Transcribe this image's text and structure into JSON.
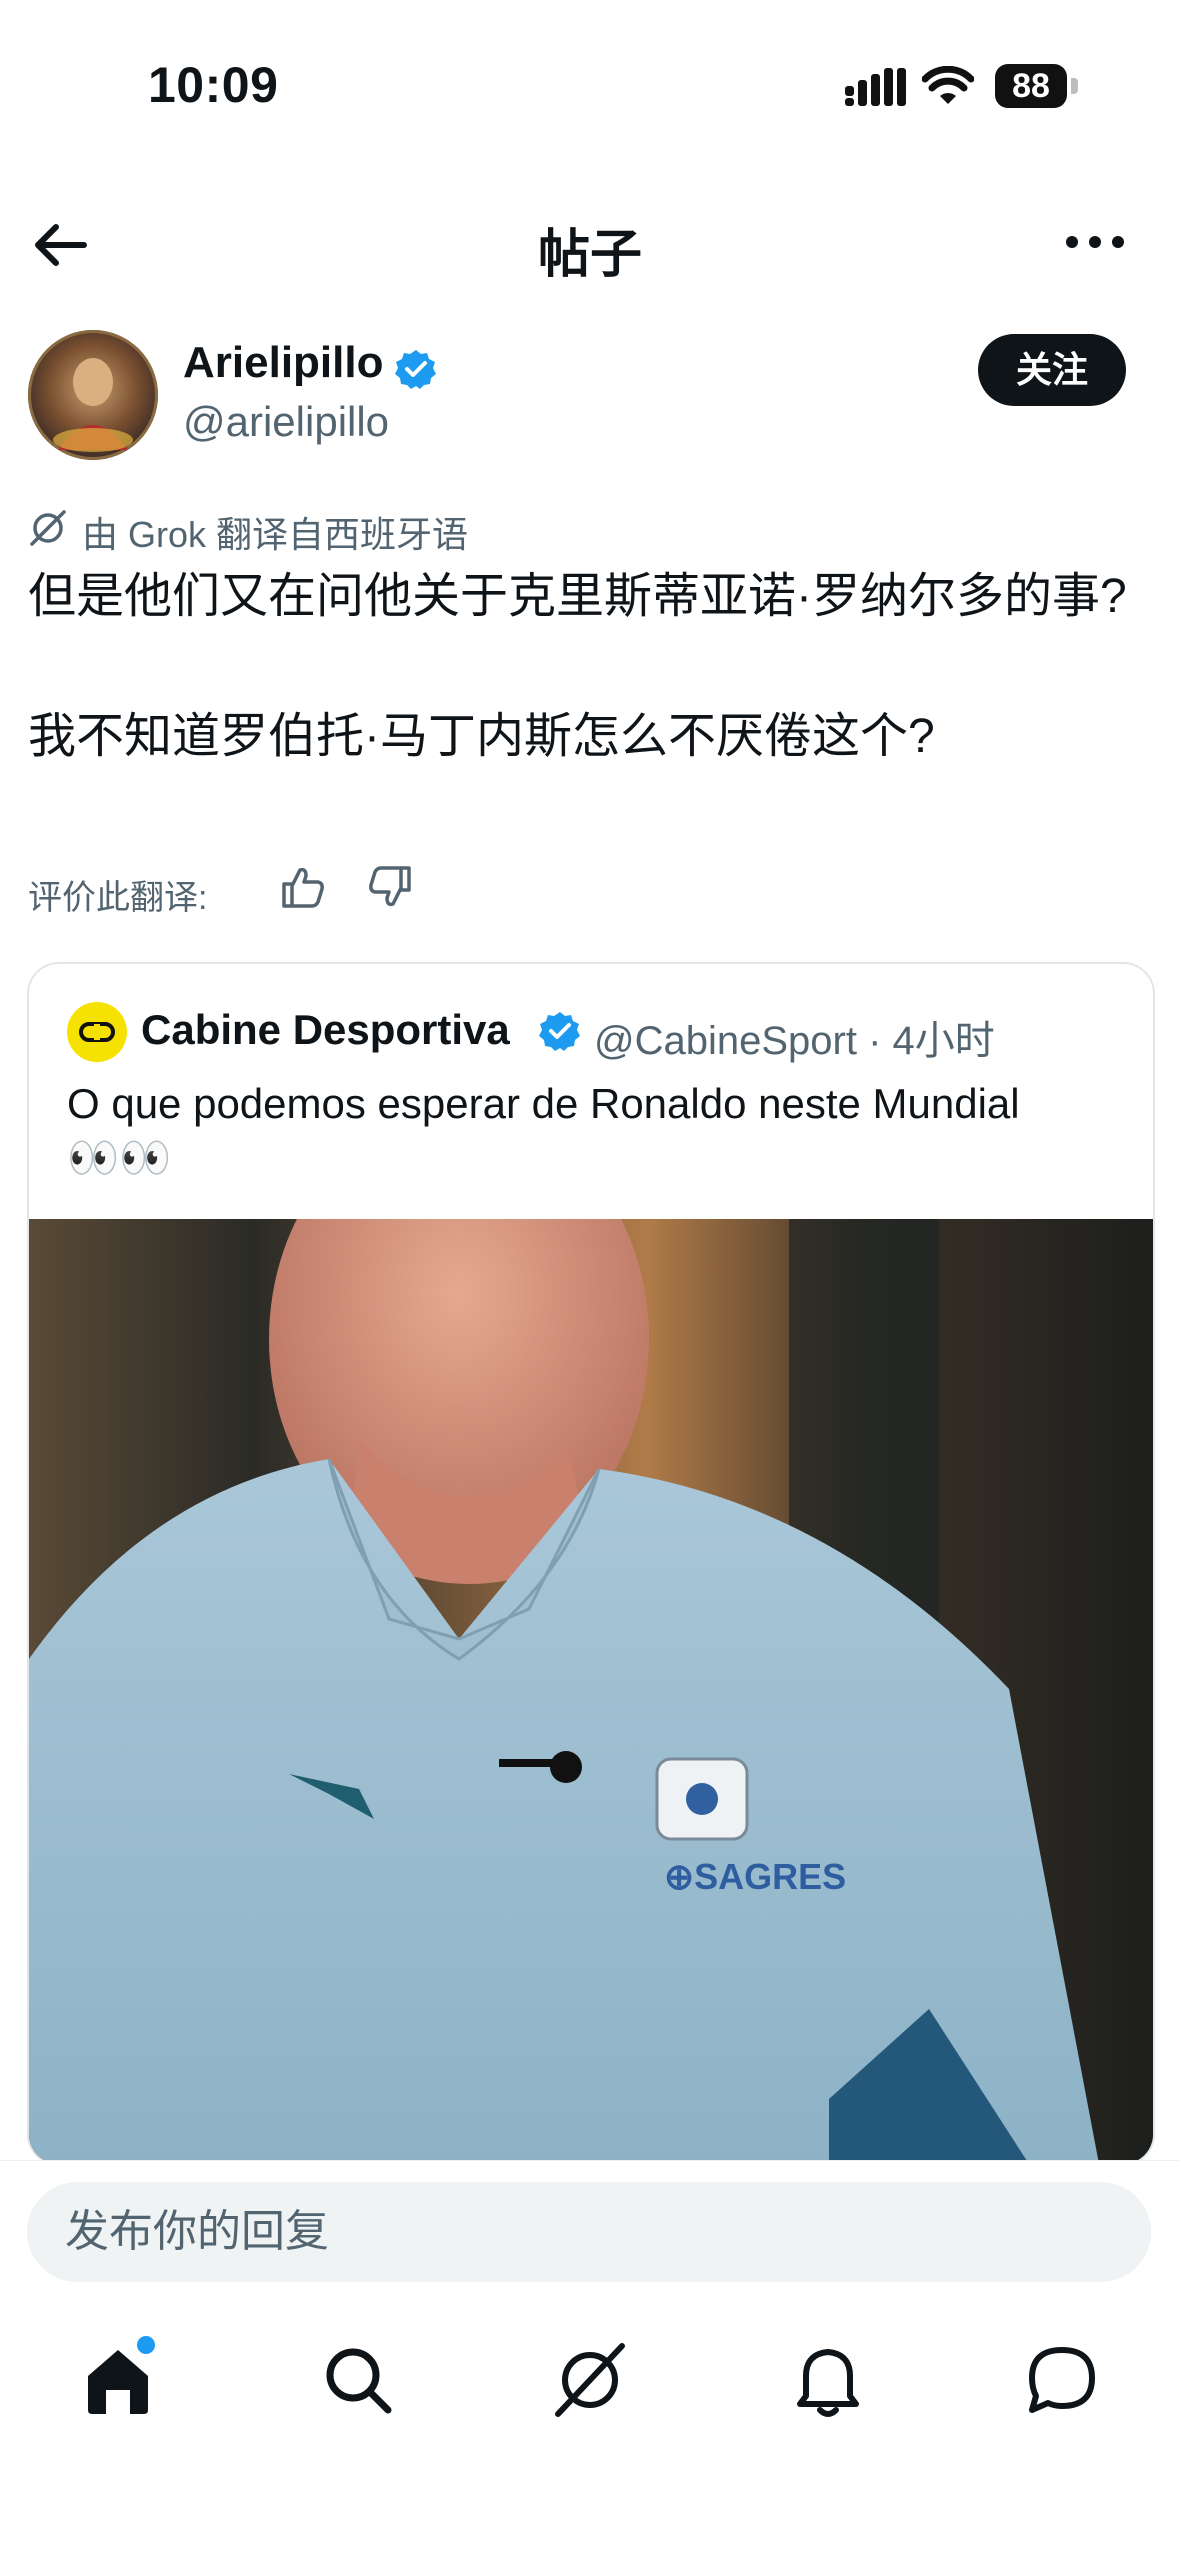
{
  "status_bar": {
    "time": "10:09",
    "battery": "88",
    "icons": [
      "cellular-signal-icon",
      "wifi-icon",
      "battery-icon"
    ]
  },
  "header": {
    "title": "帖子",
    "back_icon": "arrow-left-icon",
    "more_icon": "more-horizontal-icon"
  },
  "post": {
    "author_name": "Arielipillo",
    "author_handle": "@arielipillo",
    "follow_label": "关注",
    "translation_note": "由 Grok 翻译自西班牙语",
    "text": "但是他们又在问他关于克里斯蒂亚诺·罗纳尔多的事?\n\n我不知道罗伯托·马丁内斯怎么不厌倦这个?",
    "rate_label": "评价此翻译:"
  },
  "quoted": {
    "name": "Cabine Desportiva",
    "meta": "@CabineSport · 4小时",
    "text": "O que podemos esperar de Ronaldo neste Mundial",
    "emoji": "👀👀"
  },
  "reply": {
    "placeholder": "发布你的回复"
  },
  "tabs": [
    {
      "icon": "home-icon",
      "active": true
    },
    {
      "icon": "search-icon"
    },
    {
      "icon": "grok-icon"
    },
    {
      "icon": "bell-icon"
    },
    {
      "icon": "chat-bubble-icon"
    }
  ],
  "colors": {
    "accent": "#1d9bf0",
    "text": "#0f1419",
    "muted": "#536471",
    "button": "#0f1419"
  }
}
